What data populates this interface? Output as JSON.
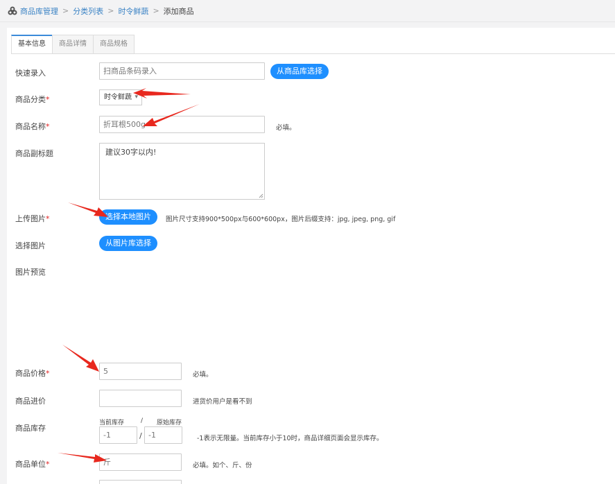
{
  "breadcrumb": {
    "items": [
      "商品库管理",
      "分类列表",
      "时令鲜蔬"
    ],
    "current": "添加商品",
    "separator": ">"
  },
  "tabs": [
    {
      "label": "基本信息",
      "active": true
    },
    {
      "label": "商品详情",
      "active": false
    },
    {
      "label": "商品规格",
      "active": false
    }
  ],
  "form": {
    "quick_entry": {
      "label": "快速录入",
      "placeholder": "扫商品条码录入",
      "button": "从商品库选择"
    },
    "category": {
      "label": "商品分类",
      "required_mark": "*",
      "selected": "时令鲜蔬"
    },
    "name": {
      "label": "商品名称",
      "required_mark": "*",
      "value": "折耳根500g",
      "hint": "必填。"
    },
    "subtitle": {
      "label": "商品副标题",
      "value": "建议30字以内!"
    },
    "upload": {
      "label": "上传图片",
      "required_mark": "*",
      "button": "选择本地图片",
      "hint": "图片尺寸支持900*500px与600*600px，图片后缀支持：jpg, jpeg, png, gif"
    },
    "select_image": {
      "label": "选择图片",
      "button": "从图片库选择"
    },
    "preview": {
      "label": "图片预览"
    },
    "price": {
      "label": "商品价格",
      "required_mark": "*",
      "value": "5",
      "hint": "必填。"
    },
    "cost": {
      "label": "商品进价",
      "value": "",
      "hint": "进货价用户是看不到"
    },
    "stock": {
      "label": "商品库存",
      "current_label": "当前库存",
      "slash": "/",
      "original_label": "原始库存",
      "current_value": "-1",
      "original_value": "-1",
      "hint": "-1表示无限量。当前库存小于10时，商品详细页面会显示库存。"
    },
    "unit": {
      "label": "商品单位",
      "required_mark": "*",
      "value": "斤",
      "hint": "必填。如个、斤、份"
    }
  },
  "colors": {
    "accent": "#1e8fff",
    "link": "#3b83c5",
    "required": "#e02020",
    "arrow": "#e8281e"
  }
}
